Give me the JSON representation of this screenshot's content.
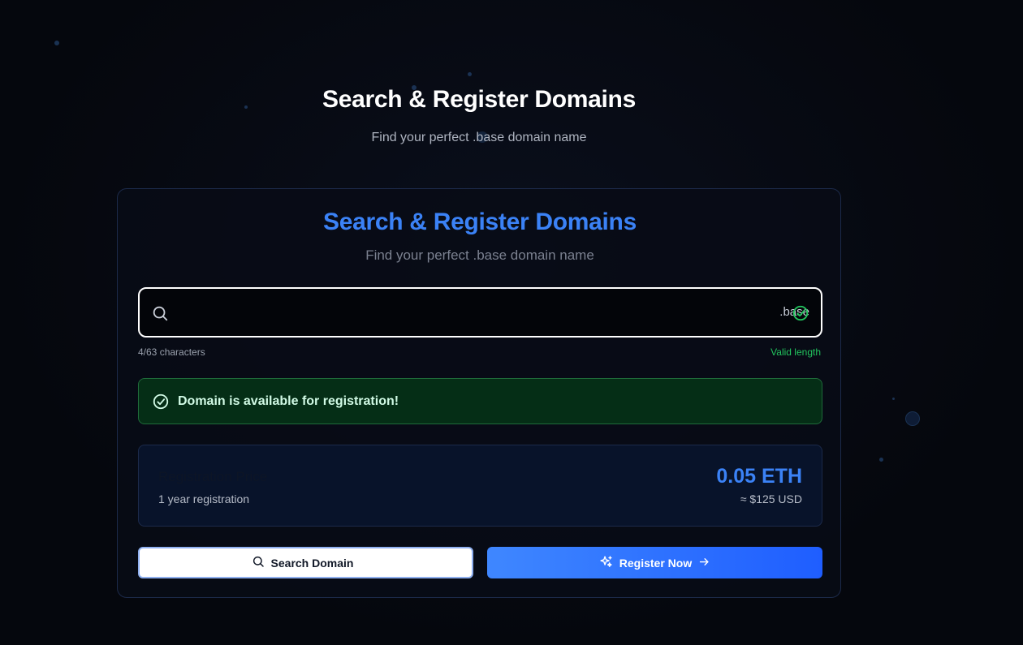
{
  "hero": {
    "title": "Search & Register Domains",
    "subtitle": "Find your perfect .base domain name"
  },
  "card": {
    "title": "Search & Register Domains",
    "subtitle": "Find your perfect .base domain name"
  },
  "search": {
    "value": "",
    "placeholder": "",
    "tld": ".base",
    "char_count": "4/63 characters",
    "validity": "Valid length"
  },
  "availability": {
    "message": "Domain is available for registration!"
  },
  "price": {
    "label": "Registration Price",
    "duration": "1 year registration",
    "eth": "0.05 ETH",
    "usd": "≈ $125 USD"
  },
  "buttons": {
    "search_label": "Search Domain",
    "register_label": "Register Now"
  },
  "colors": {
    "accent": "#3b82f6",
    "success": "#22c55e",
    "success_bg": "#052e16",
    "background": "#05070d"
  },
  "icons": {
    "search": "search-icon",
    "check": "check-circle-icon",
    "sparkles": "sparkles-icon",
    "arrow": "arrow-right-icon"
  }
}
